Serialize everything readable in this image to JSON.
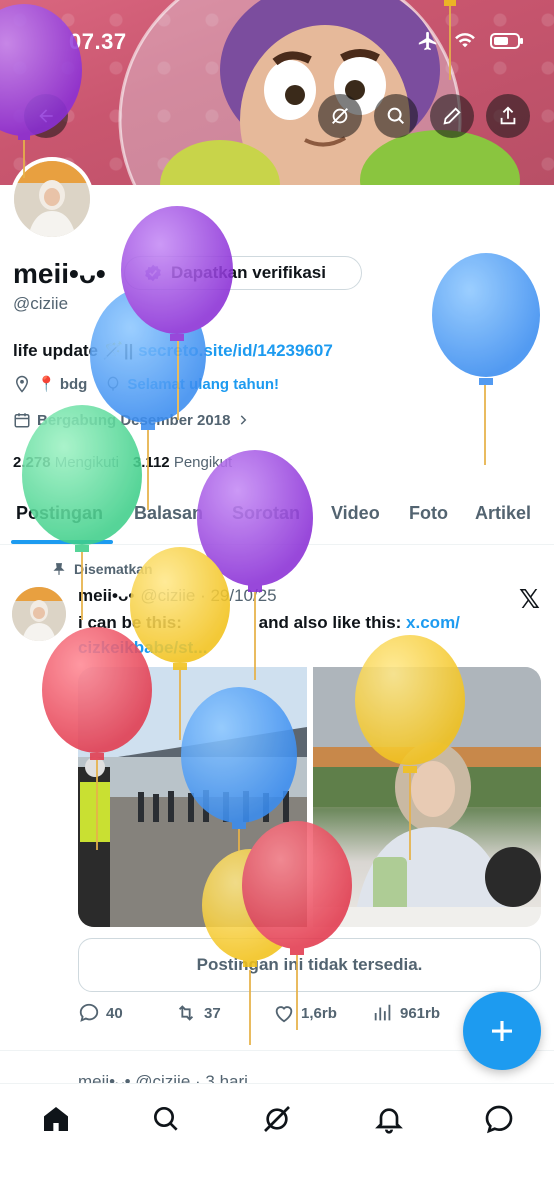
{
  "status": {
    "time": "07.37"
  },
  "profile": {
    "name": "meii•ᴗ•",
    "handle": "@ciziie",
    "verify_label": "Dapatkan verifikasi",
    "bio_text": "life update 🪄|| ",
    "bio_link": "secreto.site/id/14239607",
    "location": "📍 bdg",
    "birthday": "Selamat ulang tahun!",
    "joined": "Bergabung Desember 2018",
    "following_count": "2.278",
    "following_label": "Mengikuti",
    "followers_count": "3.112",
    "followers_label": "Pengikut"
  },
  "tabs": [
    "Postingan",
    "Balasan",
    "Sorotan",
    "Video",
    "Foto",
    "Artikel"
  ],
  "post": {
    "pinned_label": "Disematkan",
    "name": "meii•ᴗ•",
    "meta": "@ciziie · 29/10/25",
    "text_a": "i can be this:",
    "text_b": "and also like this:",
    "link_a": "x.com/",
    "link_b": "cizkeikbabe/st...",
    "quote_unavailable": "Postingan ini tidak tersedia.",
    "replies": "40",
    "reposts": "37",
    "likes": "1,6rb",
    "views": "961rb"
  },
  "next_post": {
    "preview": "meii•ᴗ• @ciziie · 3 hari"
  },
  "colors": {
    "accent": "#1d9bf0",
    "text": "#0f1419",
    "muted": "#536471"
  },
  "icons": {
    "banner_buttons": [
      "grok-icon",
      "search-icon",
      "edit-icon",
      "share-icon"
    ],
    "bottom_nav": [
      "home-icon",
      "search-icon",
      "grok-icon",
      "bell-icon",
      "messages-icon"
    ]
  }
}
